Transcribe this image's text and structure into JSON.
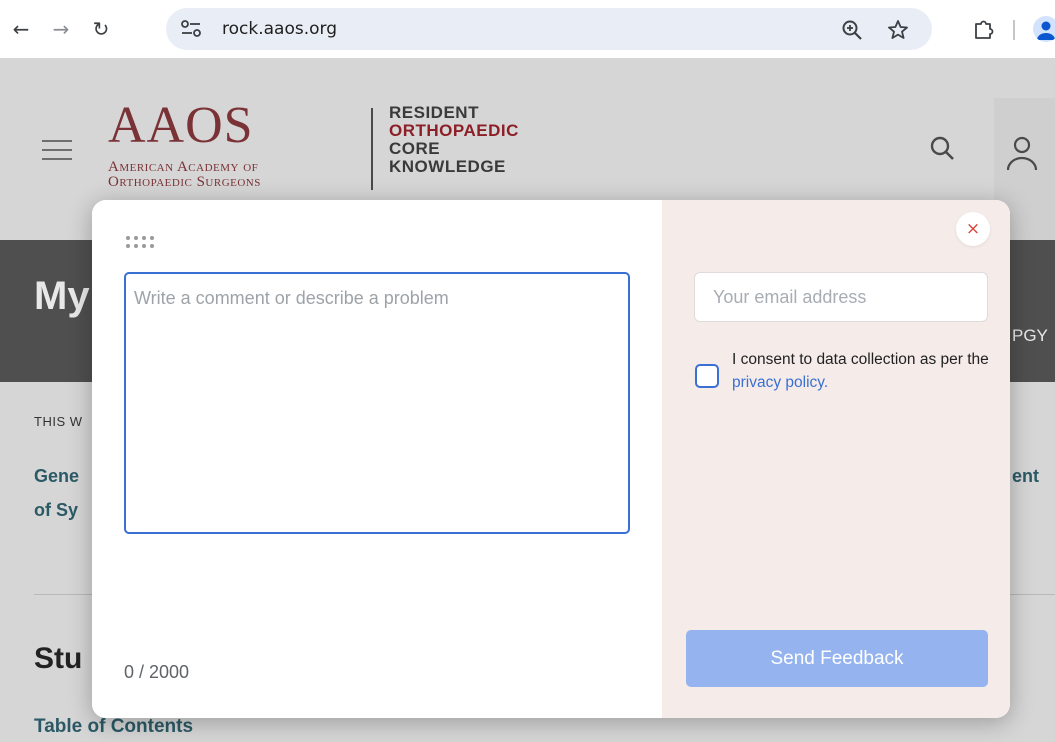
{
  "browser": {
    "url": "rock.aaos.org"
  },
  "site": {
    "aaos_letters": "AAOS",
    "aaos_line1": "American Academy of",
    "aaos_line2": "Orthopaedic Surgeons",
    "rock_line1": "RESIDENT",
    "rock_line2": "ORTHOPAEDIC",
    "rock_line3": "CORE",
    "rock_line4": "KNOWLEDGE",
    "band_title": "My",
    "band_right": "PGY",
    "this_week": "THIS W",
    "link_line1_left": "Gene",
    "link_line2_left": "of Sy",
    "link_line1_right": "ent",
    "section_title": "Stu",
    "toc": "Table of Contents"
  },
  "feedback": {
    "comment_placeholder": "Write a comment or describe a problem",
    "counter": "0 / 2000",
    "email_placeholder": "Your email address",
    "consent_text": "I consent to data collection as per the",
    "privacy_link": "privacy policy.",
    "send_label": "Send Feedback",
    "close_glyph": "×"
  },
  "colors": {
    "accent": "#3a6fd3",
    "send_button": "#95b3ef",
    "panel_right": "#f5ecea",
    "aaos_brand": "#7a3236",
    "rock_red": "#8d1f27"
  }
}
